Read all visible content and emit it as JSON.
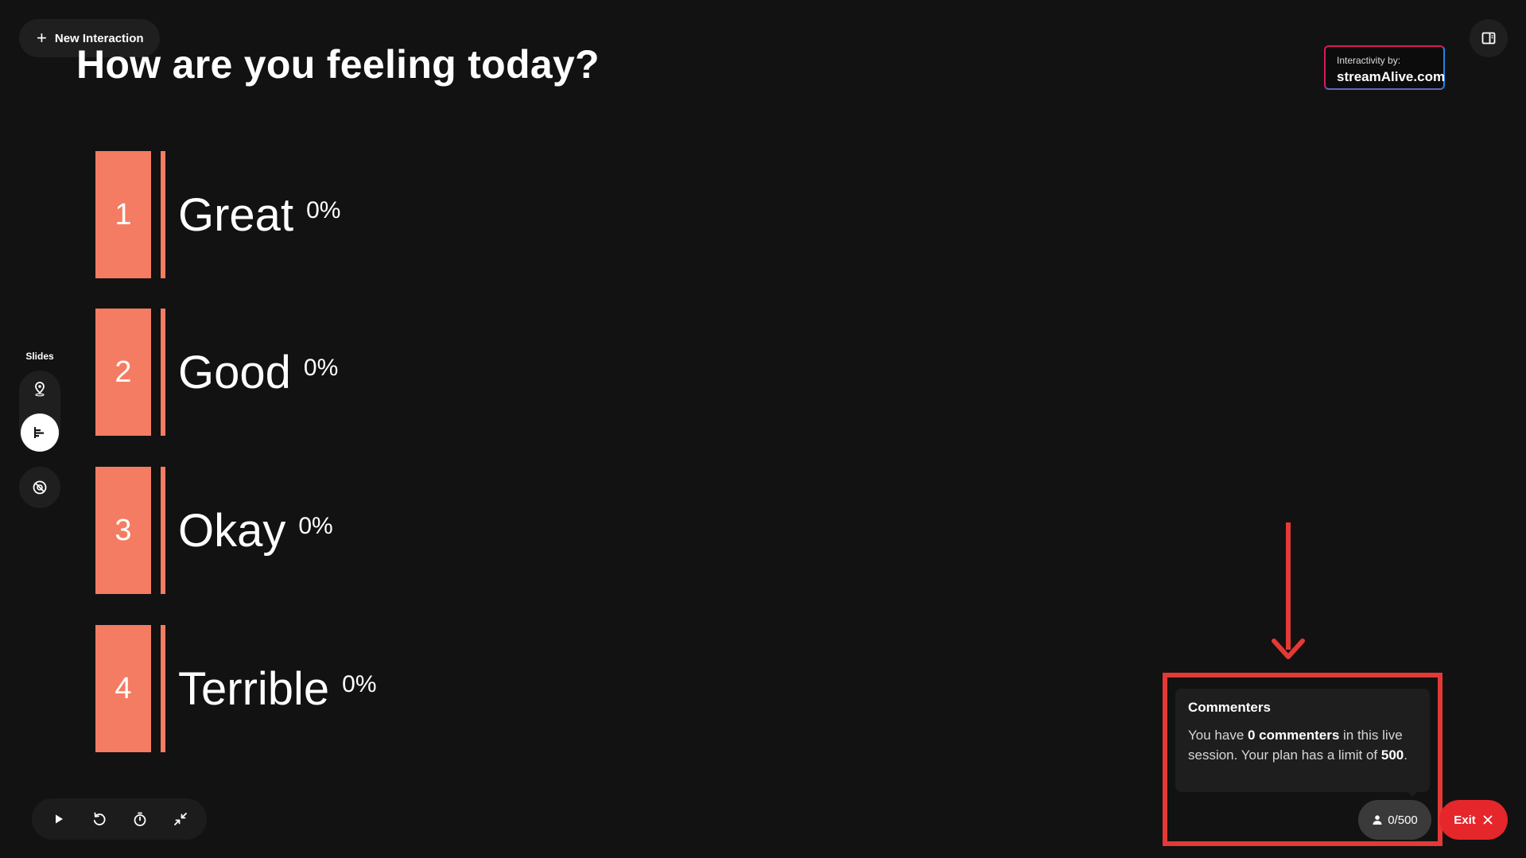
{
  "header": {
    "new_interaction_label": "New Interaction"
  },
  "question": "How are you feeling today?",
  "branding": {
    "line1": "Interactivity by:",
    "line2": "streamAlive.com"
  },
  "sidebar": {
    "label": "Slides"
  },
  "poll": {
    "accent_color": "#f47c62",
    "options": [
      {
        "number": "1",
        "label": "Great",
        "percent": "0%"
      },
      {
        "number": "2",
        "label": "Good",
        "percent": "0%"
      },
      {
        "number": "3",
        "label": "Okay",
        "percent": "0%"
      },
      {
        "number": "4",
        "label": "Terrible",
        "percent": "0%"
      }
    ]
  },
  "tooltip": {
    "title": "Commenters",
    "prefix": "You have ",
    "count_text": "0 commenters",
    "middle": " in this live session. Your plan has a limit of ",
    "limit": "500",
    "suffix": "."
  },
  "commenter_count": "0/500",
  "exit_label": "Exit",
  "icons": [
    "plus-icon",
    "panel-icon",
    "map-pin-icon",
    "bar-chart-icon",
    "no-spin-icon",
    "play-icon",
    "reset-icon",
    "timer-icon",
    "minimize-icon",
    "user-icon",
    "close-icon"
  ]
}
